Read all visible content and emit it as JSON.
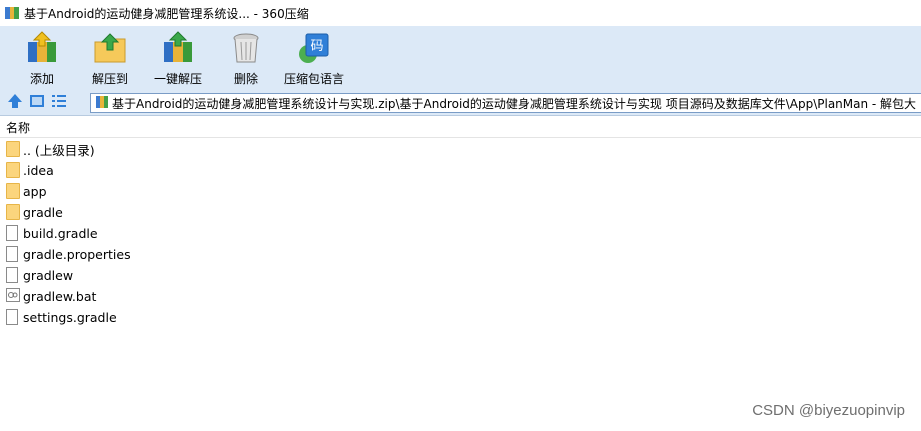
{
  "window": {
    "title": "基于Android的运动健身减肥管理系统设... - 360压缩"
  },
  "toolbar": {
    "buttons": [
      {
        "label": "添加",
        "icon": "add-archive-icon"
      },
      {
        "label": "解压到",
        "icon": "extract-to-icon"
      },
      {
        "label": "一键解压",
        "icon": "one-click-extract-icon"
      },
      {
        "label": "删除",
        "icon": "delete-bin-icon"
      },
      {
        "label": "压缩包语言",
        "icon": "archive-language-icon"
      }
    ]
  },
  "address": {
    "path": "基于Android的运动健身减肥管理系统设计与实现.zip\\基于Android的运动健身减肥管理系统设计与实现 项目源码及数据库文件\\App\\PlanMan - 解包大"
  },
  "list": {
    "header_name": "名称",
    "items": [
      {
        "name": ".. (上级目录)",
        "type": "folder"
      },
      {
        "name": ".idea",
        "type": "folder"
      },
      {
        "name": "app",
        "type": "folder"
      },
      {
        "name": "gradle",
        "type": "folder"
      },
      {
        "name": "build.gradle",
        "type": "file"
      },
      {
        "name": "gradle.properties",
        "type": "file"
      },
      {
        "name": "gradlew",
        "type": "file"
      },
      {
        "name": "gradlew.bat",
        "type": "bat"
      },
      {
        "name": "settings.gradle",
        "type": "file"
      }
    ]
  },
  "watermark": "CSDN @biyezuopinvip",
  "colors": {
    "toolbar_bg": "#dce9f7",
    "folder": "#fbd57d",
    "nav_blue": "#2f7fd8"
  }
}
